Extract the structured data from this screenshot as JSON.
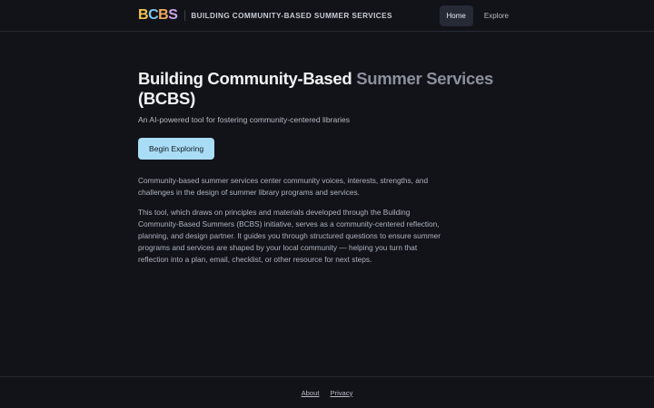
{
  "header": {
    "logo": {
      "l1": "B",
      "l2": "C",
      "l3": "B",
      "l4": "S"
    },
    "title": "BUILDING COMMUNITY-BASED SUMMER SERVICES",
    "nav": [
      {
        "label": "Home",
        "active": true
      },
      {
        "label": "Explore",
        "active": false
      }
    ]
  },
  "hero": {
    "title_main": "Building Community-Based ",
    "title_fade": "Summer Services",
    "title_tail": "(BCBS)",
    "subtitle": "An AI-powered tool for fostering community-centered libraries",
    "cta_label": "Begin Exploring"
  },
  "body": {
    "paragraph1": "Community-based summer services center community voices, interests, strengths, and challenges in the design of summer library programs and services.",
    "paragraph2": "This tool, which draws on principles and materials developed through the Building Community-Based Summers (BCBS) initiative, serves as a community-centered reflection, planning, and design partner. It guides you through structured questions to ensure summer programs and services are shaped by your local community — helping you turn that reflection into a plan, email, checklist, or other resource for next steps."
  },
  "footer": {
    "links": [
      "About",
      "Privacy"
    ]
  },
  "colors": {
    "background": "#111319",
    "cta": "#a9dcf5"
  }
}
